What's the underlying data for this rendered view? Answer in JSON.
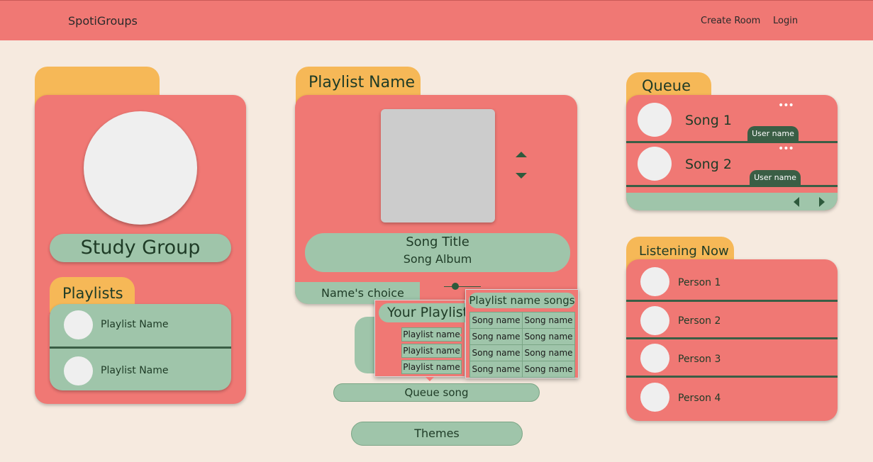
{
  "header": {
    "brand": "SpotiGroups",
    "create_room": "Create Room",
    "login": "Login"
  },
  "left": {
    "group_name": "Study Group",
    "playlists_tab": "Playlists",
    "playlists": [
      {
        "label": "Playlist Name"
      },
      {
        "label": "Playlist Name"
      }
    ]
  },
  "center": {
    "tab": "Playlist Name",
    "song_title": "Song Title",
    "song_album": "Song Album",
    "names_choice": "Name's choice",
    "your_playlists": {
      "title": "Your Playlists",
      "items": [
        "Playlist name",
        "Playlist name",
        "Playlist name"
      ]
    },
    "playlist_songs": {
      "title": "Playlist name songs",
      "rows": [
        [
          "Song name",
          "Song name"
        ],
        [
          "Song name",
          "Song name"
        ],
        [
          "Song name",
          "Song name"
        ],
        [
          "Song name",
          "Song name"
        ]
      ]
    },
    "queue_song": "Queue song",
    "themes": "Themes"
  },
  "queue": {
    "tab": "Queue",
    "items": [
      {
        "song": "Song 1",
        "user": "User name",
        "more": "•••"
      },
      {
        "song": "Song 2",
        "user": "User name",
        "more": "•••"
      }
    ]
  },
  "listening": {
    "tab": "Listening Now",
    "people": [
      "Person 1",
      "Person 2",
      "Person 3",
      "Person 4"
    ]
  },
  "colors": {
    "background": "#f6eadf",
    "coral": "#f07874",
    "sage": "#9fc5aa",
    "tab_orange": "#f6b857",
    "dark_green": "#3a5e45"
  }
}
